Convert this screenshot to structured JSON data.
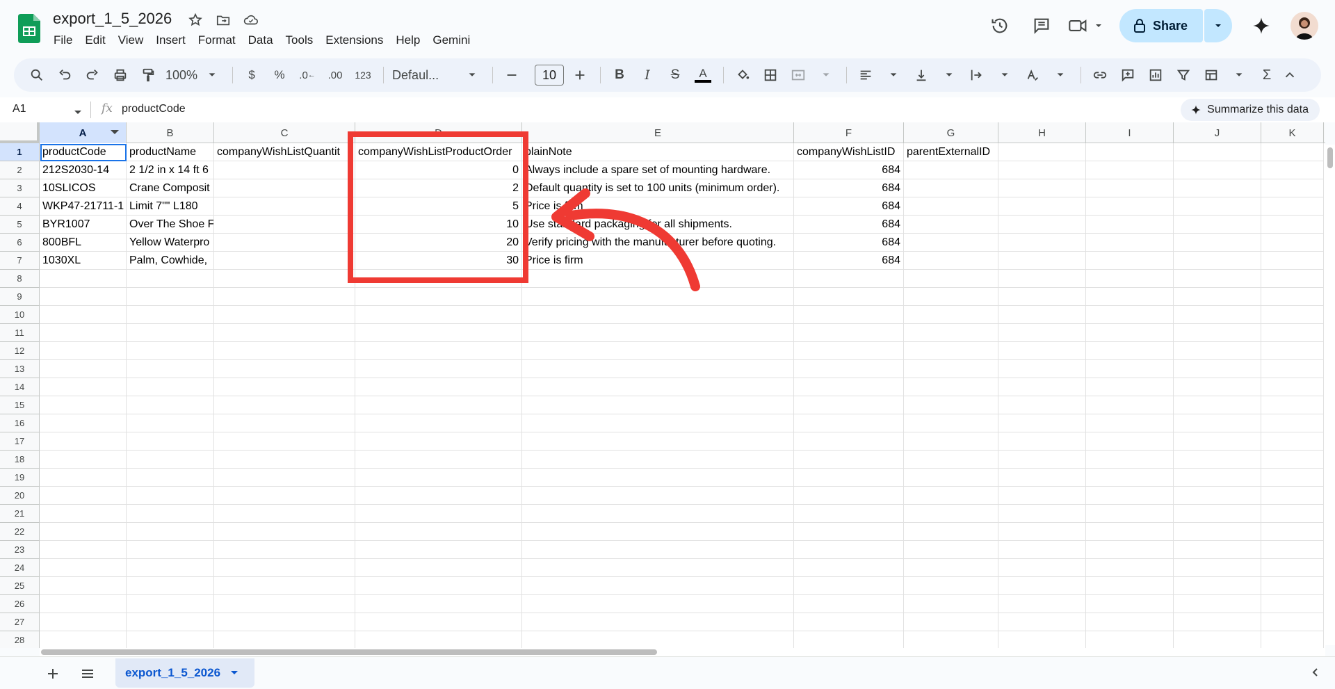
{
  "app": {
    "doc_title": "export_1_5_2026",
    "menu": [
      "File",
      "Edit",
      "View",
      "Insert",
      "Format",
      "Data",
      "Tools",
      "Extensions",
      "Help",
      "Gemini"
    ],
    "share_label": "Share"
  },
  "toolbar": {
    "zoom": "100%",
    "currency": "$",
    "percent": "%",
    "dec_decrease": ".0",
    "dec_increase": ".00",
    "number_format": "123",
    "font": "Defaul...",
    "font_size": "10",
    "sum": "Σ"
  },
  "formula_bar": {
    "name_box": "A1",
    "fx": "fx",
    "content": "productCode",
    "summarize_label": "Summarize this data"
  },
  "grid": {
    "columns": [
      "A",
      "B",
      "C",
      "D",
      "E",
      "F",
      "G",
      "H",
      "I",
      "J",
      "K"
    ],
    "row_numbers": [
      "1",
      "2",
      "3",
      "4",
      "5",
      "6",
      "7",
      "8",
      "9",
      "10",
      "11",
      "12",
      "13",
      "14",
      "15",
      "16",
      "17",
      "18",
      "19",
      "20",
      "21",
      "22",
      "23",
      "24",
      "25",
      "26",
      "27",
      "28"
    ],
    "headers": [
      "productCode",
      "productName",
      "companyWishListQuantit",
      "companyWishListProductOrder",
      "plainNote",
      "companyWishListID",
      "parentExternalID"
    ],
    "rows": [
      {
        "A": "212S2030-14",
        "B": "2 1/2 in x 14 ft 6",
        "D": "0",
        "E": "Always include a spare set of mounting hardware.",
        "F": "684"
      },
      {
        "A": "10SLICOS",
        "B": "Crane Composit",
        "D": "2",
        "E": "Default quantity is set to 100 units (minimum order).",
        "F": "684"
      },
      {
        "A": "WKP47-21711-1",
        "B": "Limit 7\"\" L180",
        "D": "5",
        "E": "Price is firm",
        "F": "684"
      },
      {
        "A": "BYR1007",
        "B": "Over The Shoe F",
        "D": "10",
        "E": "Use standard packaging for all shipments.",
        "F": "684"
      },
      {
        "A": "800BFL",
        "B": "Yellow Waterpro",
        "D": "20",
        "E": "Verify pricing with the manufacturer before quoting.",
        "F": "684"
      },
      {
        "A": "1030XL",
        "B": "Palm, Cowhide,",
        "D": "30",
        "E": "Price is firm",
        "F": "684"
      }
    ]
  },
  "sheets": {
    "active": "export_1_5_2026"
  },
  "colors": {
    "accent": "#1a73e8",
    "share_bg": "#c2e7ff",
    "annotation": "#ef3a33",
    "sheets_green": "#0f9d58"
  }
}
